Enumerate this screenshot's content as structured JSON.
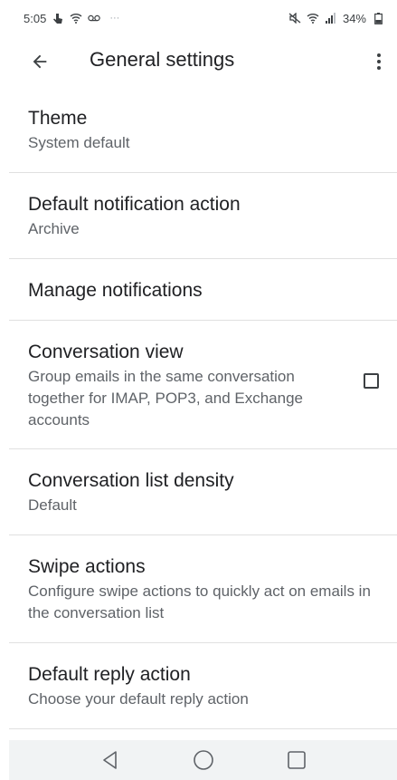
{
  "status_bar": {
    "time": "5:05",
    "battery": "34%",
    "left_icons": [
      "touch-icon",
      "wifi-call-icon",
      "voicemail-icon"
    ],
    "right_icons": [
      "mute-icon",
      "wifi-icon",
      "signal-icon",
      "battery-icon"
    ]
  },
  "app_bar": {
    "title": "General settings",
    "back_icon": "arrow-back-icon",
    "overflow_icon": "more-vert-icon"
  },
  "settings": [
    {
      "title": "Theme",
      "subtitle": "System default"
    },
    {
      "title": "Default notification action",
      "subtitle": "Archive"
    },
    {
      "title": "Manage notifications",
      "subtitle": ""
    },
    {
      "title": "Conversation view",
      "subtitle": "Group emails in the same conversation together for IMAP, POP3, and Exchange accounts",
      "checked": false
    },
    {
      "title": "Conversation list density",
      "subtitle": "Default"
    },
    {
      "title": "Swipe actions",
      "subtitle": "Configure swipe actions to quickly act on emails in the conversation list"
    },
    {
      "title": "Default reply action",
      "subtitle": "Choose your default reply action"
    }
  ],
  "nav_bar": {
    "buttons": [
      "back-triangle-icon",
      "home-circle-icon",
      "recents-square-icon"
    ]
  },
  "colors": {
    "text_primary": "#202124",
    "text_secondary": "#5f6368",
    "divider": "#e0e0e0",
    "nav_bg": "#f1f3f4"
  }
}
